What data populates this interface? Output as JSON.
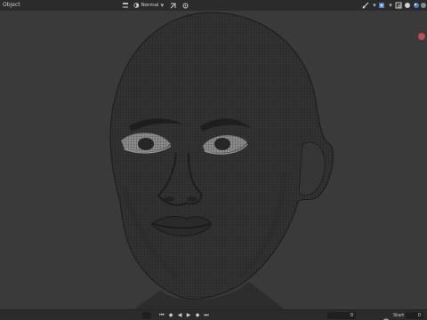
{
  "header": {
    "mode_label": "Object",
    "shading_dropdown": {
      "label": "Normal"
    }
  },
  "viewport": {
    "subject": "wireframe head mesh"
  },
  "footer": {
    "current_frame": "0",
    "start_label": "Start",
    "start_value": "0"
  },
  "colors": {
    "header_bg": "#2b2b2b",
    "viewport_bg": "#3a3a3a",
    "gizmo_red": "#c14a55",
    "mesh_fill": "#333333",
    "wire": "#1c1c1c"
  },
  "icons": [
    "cursor-icon",
    "snap-icon",
    "shading-icon",
    "overlay-icon",
    "xray-icon",
    "solid-icon",
    "material-icon",
    "rendered-icon",
    "viewport-gizmo-red",
    "jump-start-icon",
    "prev-key-icon",
    "play-reverse-icon",
    "play-icon",
    "next-key-icon",
    "jump-end-icon",
    "clock-icon"
  ]
}
